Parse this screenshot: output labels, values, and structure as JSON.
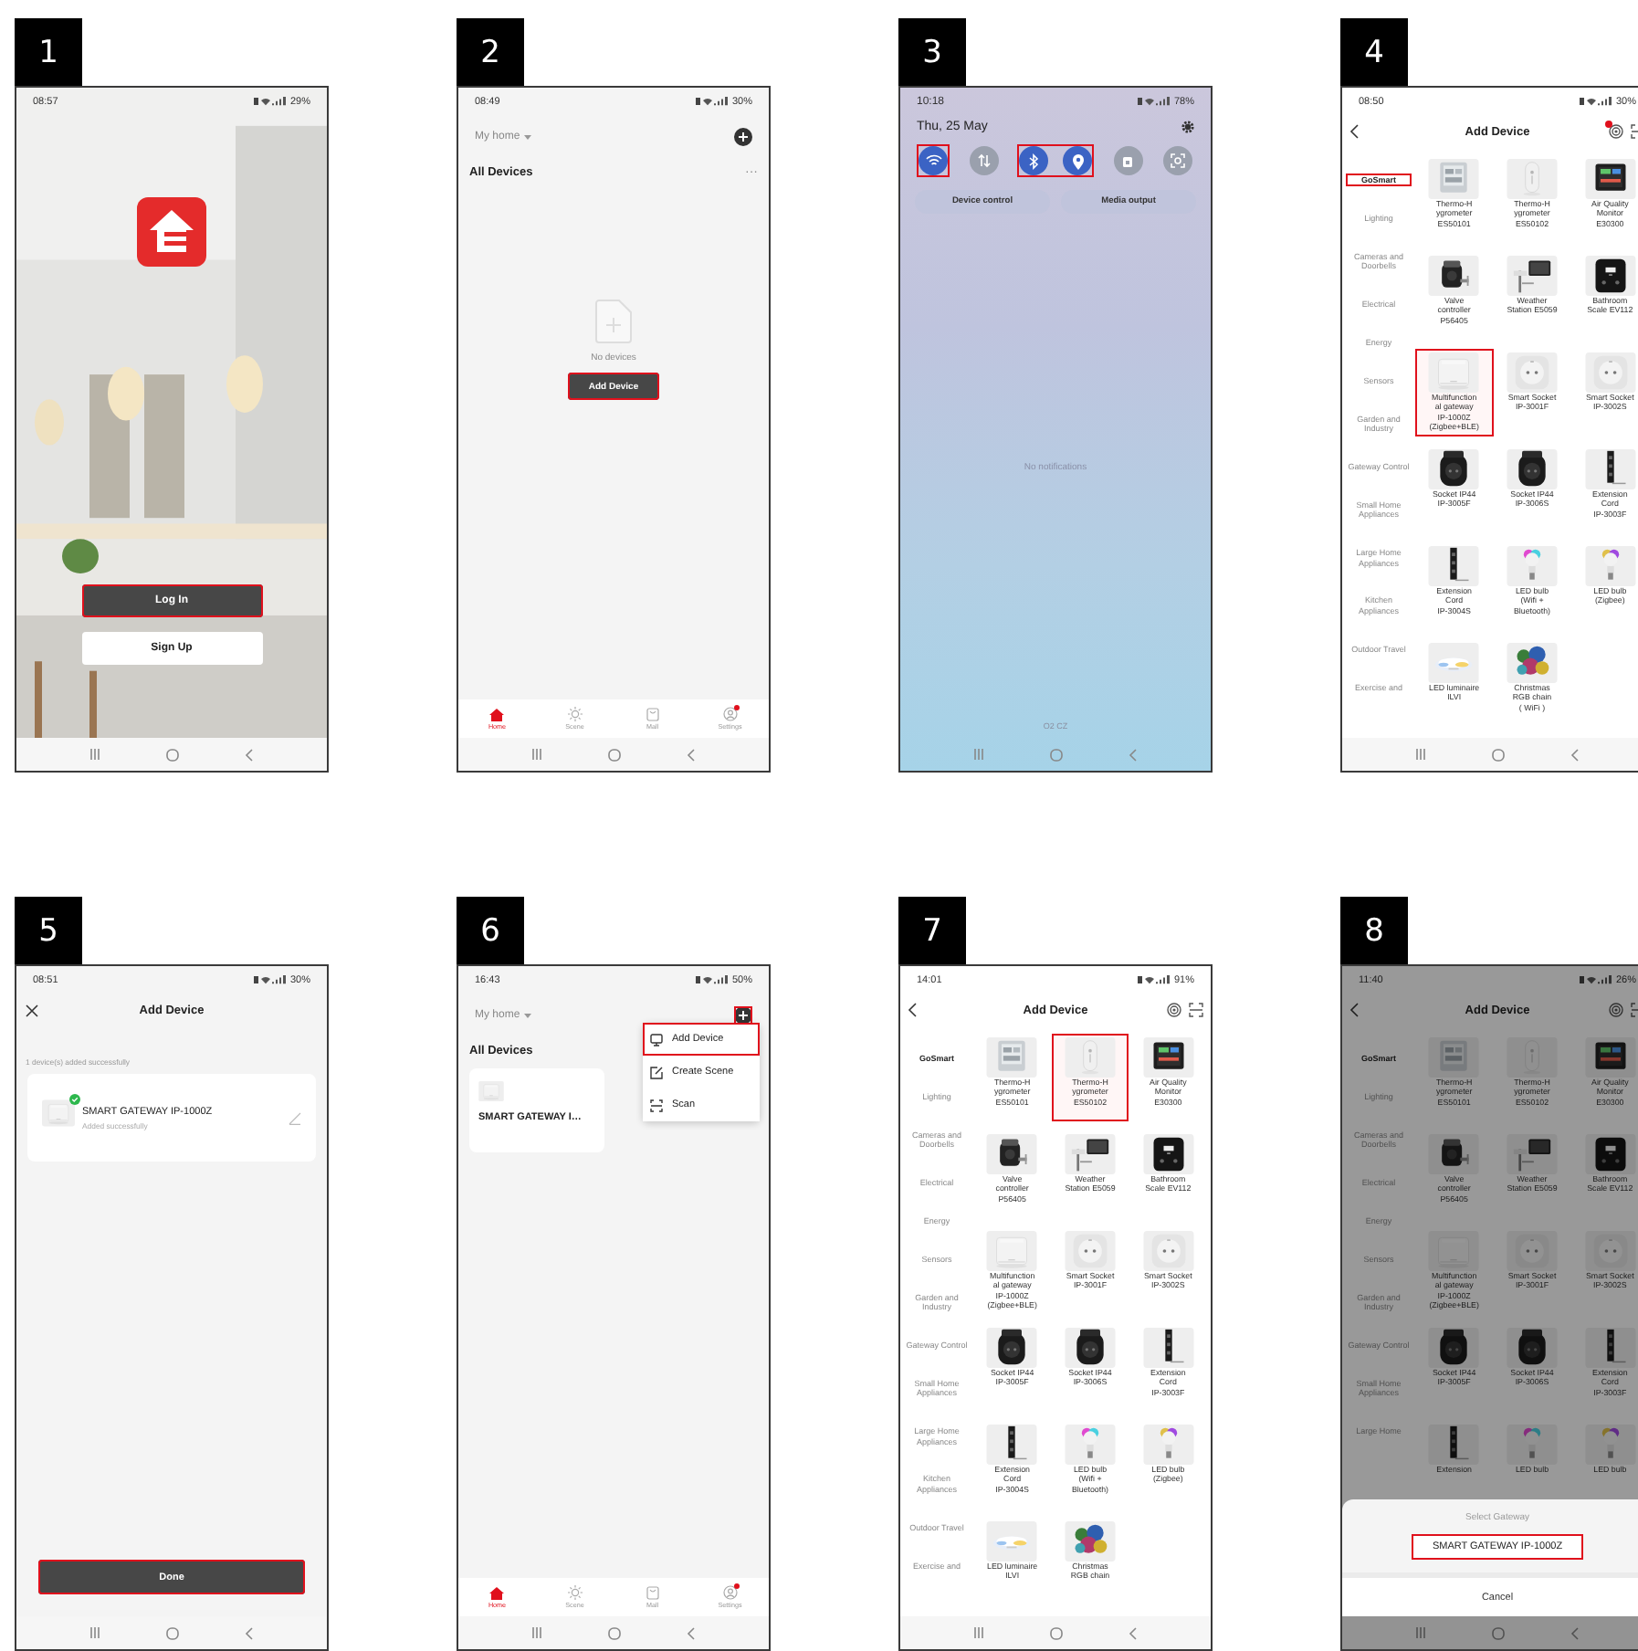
{
  "steps": [
    {
      "number": "1",
      "screen": {
        "kind": "login",
        "status": {
          "time": "08:57",
          "battery": "29%"
        },
        "buttons": [
          {
            "label": "Log In",
            "primary": true,
            "highlighted": true
          },
          {
            "label": "Sign Up",
            "primary": false,
            "highlighted": false
          }
        ]
      }
    },
    {
      "number": "2",
      "screen": {
        "kind": "home",
        "status": {
          "time": "08:49",
          "battery": "30%"
        },
        "home_name": "My home",
        "add_highlighted": false,
        "section": "All Devices",
        "more": "···",
        "empty_text": "No devices",
        "add_button": {
          "label": "Add Device",
          "highlighted": true
        },
        "nav": [
          {
            "label": "Home",
            "selected": true,
            "badge": false
          },
          {
            "label": "Scene",
            "selected": false,
            "badge": false
          },
          {
            "label": "Mall",
            "selected": false,
            "badge": false
          },
          {
            "label": "Settings",
            "selected": false,
            "badge": true
          }
        ]
      }
    },
    {
      "number": "3",
      "screen": {
        "kind": "quick_panel",
        "status": {
          "time": "10:18",
          "battery": "78%"
        },
        "date": "Thu, 25 May",
        "tile_groups": [
          {
            "highlighted": true,
            "tiles": [
              {
                "on": true
              }
            ]
          },
          {
            "highlighted": false,
            "tiles": [
              {
                "on": false
              }
            ]
          },
          {
            "highlighted": true,
            "tiles": [
              {
                "on": true
              },
              {
                "on": true
              }
            ]
          },
          {
            "highlighted": false,
            "tiles": [
              {
                "on": false
              }
            ]
          },
          {
            "highlighted": false,
            "tiles": [
              {
                "on": false
              }
            ]
          }
        ],
        "buttons": [
          "Device control",
          "Media output"
        ],
        "empty_text": "No notifications",
        "carrier": "O2 CZ"
      }
    },
    {
      "number": "4",
      "screen": {
        "kind": "catalog",
        "status": {
          "time": "08:50",
          "battery": "30%"
        },
        "title": "Add Device",
        "alert": true,
        "categories": [
          {
            "label": "GoSmart",
            "selected": true,
            "highlighted": true
          },
          {
            "label": "Lighting",
            "selected": false,
            "highlighted": false
          },
          {
            "label": "Cameras and Doorbells",
            "selected": false,
            "highlighted": false
          },
          {
            "label": "Electrical",
            "selected": false,
            "highlighted": false
          },
          {
            "label": "Energy",
            "selected": false,
            "highlighted": false
          },
          {
            "label": "Sensors",
            "selected": false,
            "highlighted": false
          },
          {
            "label": "Garden and Industry",
            "selected": false,
            "highlighted": false
          },
          {
            "label": "Gateway Control",
            "selected": false,
            "highlighted": false
          },
          {
            "label": "Small Home Appliances",
            "selected": false,
            "highlighted": false
          },
          {
            "label": "Large Home Appliances",
            "selected": false,
            "highlighted": false
          },
          {
            "label": "Kitchen Appliances",
            "selected": false,
            "highlighted": false
          },
          {
            "label": "Outdoor Travel",
            "selected": false,
            "highlighted": false
          },
          {
            "label": "Exercise and",
            "selected": false,
            "highlighted": false
          }
        ],
        "products": [
          {
            "lines": [
              "Thermo-H",
              "ygrometer",
              "ES50101"
            ],
            "highlighted": false
          },
          {
            "lines": [
              "Thermo-H",
              "ygrometer",
              "ES50102"
            ],
            "highlighted": false
          },
          {
            "lines": [
              "Air Quality",
              "Monitor",
              "E30300"
            ],
            "highlighted": false
          },
          {
            "lines": [
              "Valve",
              "controller",
              "P56405"
            ],
            "highlighted": false
          },
          {
            "lines": [
              "Weather",
              "Station E5059"
            ],
            "highlighted": false
          },
          {
            "lines": [
              "Bathroom",
              "Scale EV112"
            ],
            "highlighted": false
          },
          {
            "lines": [
              "Multifunction",
              "al gateway",
              "IP-1000Z",
              "(Zigbee+BLE)"
            ],
            "highlighted": true
          },
          {
            "lines": [
              "Smart Socket",
              "IP-3001F"
            ],
            "highlighted": false
          },
          {
            "lines": [
              "Smart Socket",
              "IP-3002S"
            ],
            "highlighted": false
          },
          {
            "lines": [
              "Socket IP44",
              "IP-3005F"
            ],
            "highlighted": false
          },
          {
            "lines": [
              "Socket IP44",
              "IP-3006S"
            ],
            "highlighted": false
          },
          {
            "lines": [
              "Extension",
              "Cord",
              "IP-3003F"
            ],
            "highlighted": false
          },
          {
            "lines": [
              "Extension",
              "Cord",
              "IP-3004S"
            ],
            "highlighted": false
          },
          {
            "lines": [
              "LED bulb",
              "(Wifi +",
              "Bluetooth)"
            ],
            "highlighted": false
          },
          {
            "lines": [
              "LED bulb",
              "(Zigbee)"
            ],
            "highlighted": false
          },
          {
            "lines": [
              "LED luminaire",
              "ILVI"
            ],
            "highlighted": false
          },
          {
            "lines": [
              "Christmas",
              "RGB chain",
              "( WiFi )"
            ],
            "highlighted": false
          }
        ]
      }
    },
    {
      "number": "5",
      "screen": {
        "kind": "added",
        "status": {
          "time": "08:51",
          "battery": "30%"
        },
        "title": "Add Device",
        "summary": "1 device(s) added successfully",
        "device": {
          "name": "SMART GATEWAY IP-1000Z",
          "status": "Added successfully"
        },
        "done": {
          "label": "Done",
          "highlighted": true
        }
      }
    },
    {
      "number": "6",
      "screen": {
        "kind": "home",
        "status": {
          "time": "16:43",
          "battery": "50%"
        },
        "home_name": "My home",
        "add_highlighted": true,
        "section": "All Devices",
        "devices": [
          {
            "name": "SMART GATEWAY I…"
          }
        ],
        "menu": [
          {
            "label": "Add Device",
            "highlighted": true
          },
          {
            "label": "Create Scene",
            "highlighted": false
          },
          {
            "label": "Scan",
            "highlighted": false
          }
        ],
        "nav": [
          {
            "label": "Home",
            "selected": true,
            "badge": false
          },
          {
            "label": "Scene",
            "selected": false,
            "badge": false
          },
          {
            "label": "Mall",
            "selected": false,
            "badge": false
          },
          {
            "label": "Settings",
            "selected": false,
            "badge": true
          }
        ]
      }
    },
    {
      "number": "7",
      "screen": {
        "kind": "catalog",
        "status": {
          "time": "14:01",
          "battery": "91%"
        },
        "title": "Add Device",
        "alert": false,
        "categories": [
          {
            "label": "GoSmart",
            "selected": true,
            "highlighted": false
          },
          {
            "label": "Lighting",
            "selected": false,
            "highlighted": false
          },
          {
            "label": "Cameras and Doorbells",
            "selected": false,
            "highlighted": false
          },
          {
            "label": "Electrical",
            "selected": false,
            "highlighted": false
          },
          {
            "label": "Energy",
            "selected": false,
            "highlighted": false
          },
          {
            "label": "Sensors",
            "selected": false,
            "highlighted": false
          },
          {
            "label": "Garden and Industry",
            "selected": false,
            "highlighted": false
          },
          {
            "label": "Gateway Control",
            "selected": false,
            "highlighted": false
          },
          {
            "label": "Small Home Appliances",
            "selected": false,
            "highlighted": false
          },
          {
            "label": "Large Home Appliances",
            "selected": false,
            "highlighted": false
          },
          {
            "label": "Kitchen Appliances",
            "selected": false,
            "highlighted": false
          },
          {
            "label": "Outdoor Travel",
            "selected": false,
            "highlighted": false
          },
          {
            "label": "Exercise and",
            "selected": false,
            "highlighted": false
          }
        ],
        "products": [
          {
            "lines": [
              "Thermo-H",
              "ygrometer",
              "ES50101"
            ],
            "highlighted": false
          },
          {
            "lines": [
              "Thermo-H",
              "ygrometer",
              "ES50102"
            ],
            "highlighted": true
          },
          {
            "lines": [
              "Air Quality",
              "Monitor",
              "E30300"
            ],
            "highlighted": false
          },
          {
            "lines": [
              "Valve",
              "controller",
              "P56405"
            ],
            "highlighted": false
          },
          {
            "lines": [
              "Weather",
              "Station E5059"
            ],
            "highlighted": false
          },
          {
            "lines": [
              "Bathroom",
              "Scale EV112"
            ],
            "highlighted": false
          },
          {
            "lines": [
              "Multifunction",
              "al gateway",
              "IP-1000Z",
              "(Zigbee+BLE)"
            ],
            "highlighted": false
          },
          {
            "lines": [
              "Smart Socket",
              "IP-3001F"
            ],
            "highlighted": false
          },
          {
            "lines": [
              "Smart Socket",
              "IP-3002S"
            ],
            "highlighted": false
          },
          {
            "lines": [
              "Socket IP44",
              "IP-3005F"
            ],
            "highlighted": false
          },
          {
            "lines": [
              "Socket IP44",
              "IP-3006S"
            ],
            "highlighted": false
          },
          {
            "lines": [
              "Extension",
              "Cord",
              "IP-3003F"
            ],
            "highlighted": false
          },
          {
            "lines": [
              "Extension",
              "Cord",
              "IP-3004S"
            ],
            "highlighted": false
          },
          {
            "lines": [
              "LED bulb",
              "(Wifi +",
              "Bluetooth)"
            ],
            "highlighted": false
          },
          {
            "lines": [
              "LED bulb",
              "(Zigbee)"
            ],
            "highlighted": false
          },
          {
            "lines": [
              "LED luminaire",
              "ILVI"
            ],
            "highlighted": false
          },
          {
            "lines": [
              "Christmas",
              "RGB chain"
            ],
            "highlighted": false
          }
        ]
      }
    },
    {
      "number": "8",
      "screen": {
        "kind": "catalog",
        "status": {
          "time": "11:40",
          "battery": "26%"
        },
        "title": "Add Device",
        "alert": false,
        "categories": [
          {
            "label": "GoSmart",
            "selected": true,
            "highlighted": false
          },
          {
            "label": "Lighting",
            "selected": false,
            "highlighted": false
          },
          {
            "label": "Cameras and Doorbells",
            "selected": false,
            "highlighted": false
          },
          {
            "label": "Electrical",
            "selected": false,
            "highlighted": false
          },
          {
            "label": "Energy",
            "selected": false,
            "highlighted": false
          },
          {
            "label": "Sensors",
            "selected": false,
            "highlighted": false
          },
          {
            "label": "Garden and Industry",
            "selected": false,
            "highlighted": false
          },
          {
            "label": "Gateway Control",
            "selected": false,
            "highlighted": false
          },
          {
            "label": "Small Home Appliances",
            "selected": false,
            "highlighted": false
          },
          {
            "label": "Large Home",
            "selected": false,
            "highlighted": false
          }
        ],
        "products": [
          {
            "lines": [
              "Thermo-H",
              "ygrometer",
              "ES50101"
            ],
            "highlighted": false
          },
          {
            "lines": [
              "Thermo-H",
              "ygrometer",
              "ES50102"
            ],
            "highlighted": false
          },
          {
            "lines": [
              "Air Quality",
              "Monitor",
              "E30300"
            ],
            "highlighted": false
          },
          {
            "lines": [
              "Valve",
              "controller",
              "P56405"
            ],
            "highlighted": false
          },
          {
            "lines": [
              "Weather",
              "Station E5059"
            ],
            "highlighted": false
          },
          {
            "lines": [
              "Bathroom",
              "Scale EV112"
            ],
            "highlighted": false
          },
          {
            "lines": [
              "Multifunction",
              "al gateway",
              "IP-1000Z",
              "(Zigbee+BLE)"
            ],
            "highlighted": false
          },
          {
            "lines": [
              "Smart Socket",
              "IP-3001F"
            ],
            "highlighted": false
          },
          {
            "lines": [
              "Smart Socket",
              "IP-3002S"
            ],
            "highlighted": false
          },
          {
            "lines": [
              "Socket IP44",
              "IP-3005F"
            ],
            "highlighted": false
          },
          {
            "lines": [
              "Socket IP44",
              "IP-3006S"
            ],
            "highlighted": false
          },
          {
            "lines": [
              "Extension",
              "Cord",
              "IP-3003F"
            ],
            "highlighted": false
          },
          {
            "lines": [
              "Extension"
            ],
            "highlighted": false
          },
          {
            "lines": [
              "LED bulb"
            ],
            "highlighted": false
          },
          {
            "lines": [
              "LED bulb"
            ],
            "highlighted": false
          }
        ],
        "sheet": {
          "title": "Select Gateway",
          "option": {
            "label": "SMART GATEWAY IP-1000Z",
            "highlighted": true
          },
          "cancel": "Cancel"
        }
      }
    }
  ]
}
